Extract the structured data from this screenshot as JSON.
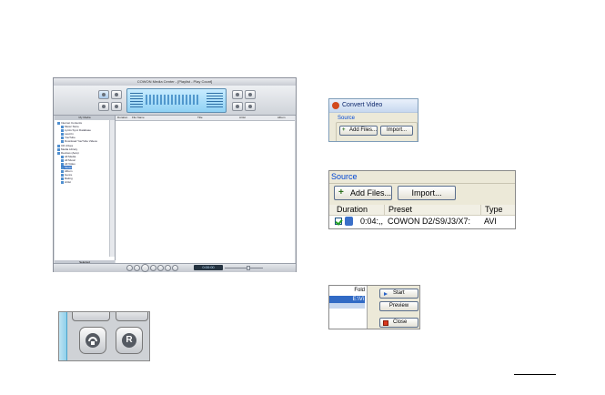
{
  "media_center": {
    "title": "COWON Media Center - [Playlist - Play Count]",
    "tree_header": "My Media",
    "tree_items": [
      "Internet Contents",
      "Music Store",
      "Lyrics Sync Database",
      "Last.fm",
      "YouTube",
      "Download YouTube Videos",
      "CD drives",
      "Media Library",
      "Devices (Auto)",
      "All Media",
      "All Music",
      "All Video",
      "Music",
      "Album",
      "Genre",
      "Rating",
      "Artist"
    ],
    "selected_tree_item": "Music",
    "selected_header": "Selected",
    "columns": [
      "Duration",
      "File Name",
      "Title",
      "Artist",
      "Album"
    ],
    "time": "0:00:00"
  },
  "convert_dialog": {
    "title": "Convert Video",
    "source_label": "Source",
    "add_files": "Add Files...",
    "import": "Import..."
  },
  "source_panel": {
    "label": "Source",
    "add_files": "Add Files...",
    "import": "Import...",
    "columns": [
      "Duration",
      "Preset",
      "Type"
    ],
    "row": {
      "duration": "0:04:,,",
      "preset": "COWON D2/S9/J3/X7:",
      "type": "AVI"
    }
  },
  "actions_panel": {
    "folder_label": "Fold",
    "selected_label": "E:\\Vi",
    "start": "Start",
    "preview": "Preview",
    "close": "Close"
  },
  "icons": {
    "repeat_button": "repeat-icon",
    "shuffle_button": "r-icon"
  },
  "colors": {
    "lcd": "#8fd1f4",
    "xp_face": "#ece9d8",
    "selection": "#316ac5"
  }
}
